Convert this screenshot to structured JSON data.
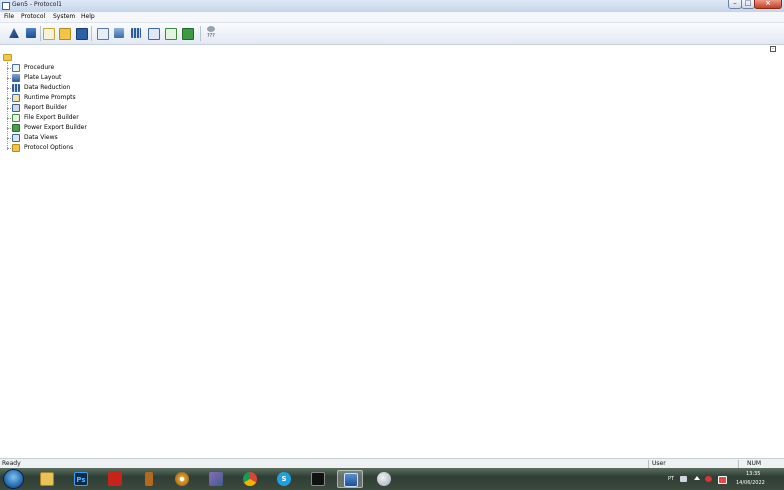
{
  "window": {
    "title": "Gen5 - Protocol1"
  },
  "menu": [
    "File",
    "Protocol",
    "System",
    "Help"
  ],
  "toolbar": {
    "buttons": [
      {
        "icon": "reader-control-icon"
      },
      {
        "icon": "read-plate-icon"
      },
      {
        "icon": "new-protocol-icon"
      },
      {
        "icon": "open-folder-icon"
      },
      {
        "icon": "save-icon"
      },
      {
        "icon": "procedure-icon"
      },
      {
        "icon": "plate-layout-icon"
      },
      {
        "icon": "data-table-icon"
      },
      {
        "icon": "report-icon"
      },
      {
        "icon": "export-icon"
      },
      {
        "icon": "excel-export-icon"
      },
      {
        "icon": "help-icon"
      }
    ],
    "help_label": "???"
  },
  "tree": {
    "root_icon": "protocol-folder-icon",
    "items": [
      {
        "label": "Procedure",
        "icon": "procedure-icon"
      },
      {
        "label": "Plate Layout",
        "icon": "plate-layout-icon"
      },
      {
        "label": "Data Reduction",
        "icon": "data-reduction-icon"
      },
      {
        "label": "Runtime Prompts",
        "icon": "runtime-prompts-icon"
      },
      {
        "label": "Report Builder",
        "icon": "report-builder-icon"
      },
      {
        "label": "File Export Builder",
        "icon": "file-export-icon"
      },
      {
        "label": "Power Export Builder",
        "icon": "power-export-icon"
      },
      {
        "label": "Data Views",
        "icon": "data-views-icon"
      },
      {
        "label": "Protocol Options",
        "icon": "protocol-options-icon"
      }
    ]
  },
  "statusbar": {
    "status": "Ready",
    "user": "User",
    "num": "NUM"
  },
  "taskbar": {
    "apps": [
      {
        "name": "explorer",
        "icon": "folder-icon"
      },
      {
        "name": "photoshop",
        "icon": "photoshop-icon",
        "text": "Ps"
      },
      {
        "name": "acrobat",
        "icon": "acrobat-icon"
      },
      {
        "name": "app4",
        "icon": "bottle-icon"
      },
      {
        "name": "app5",
        "icon": "disc-icon"
      },
      {
        "name": "app6",
        "icon": "shield-icon"
      },
      {
        "name": "chrome",
        "icon": "chrome-icon"
      },
      {
        "name": "skype",
        "icon": "skype-icon",
        "text": "S"
      },
      {
        "name": "app9",
        "icon": "media-icon"
      },
      {
        "name": "gen5",
        "icon": "gen5-icon",
        "active": true
      },
      {
        "name": "app11",
        "icon": "paint-icon"
      }
    ],
    "tray": {
      "lang": "PT",
      "time": "13:35",
      "date": "14/06/2022"
    }
  }
}
